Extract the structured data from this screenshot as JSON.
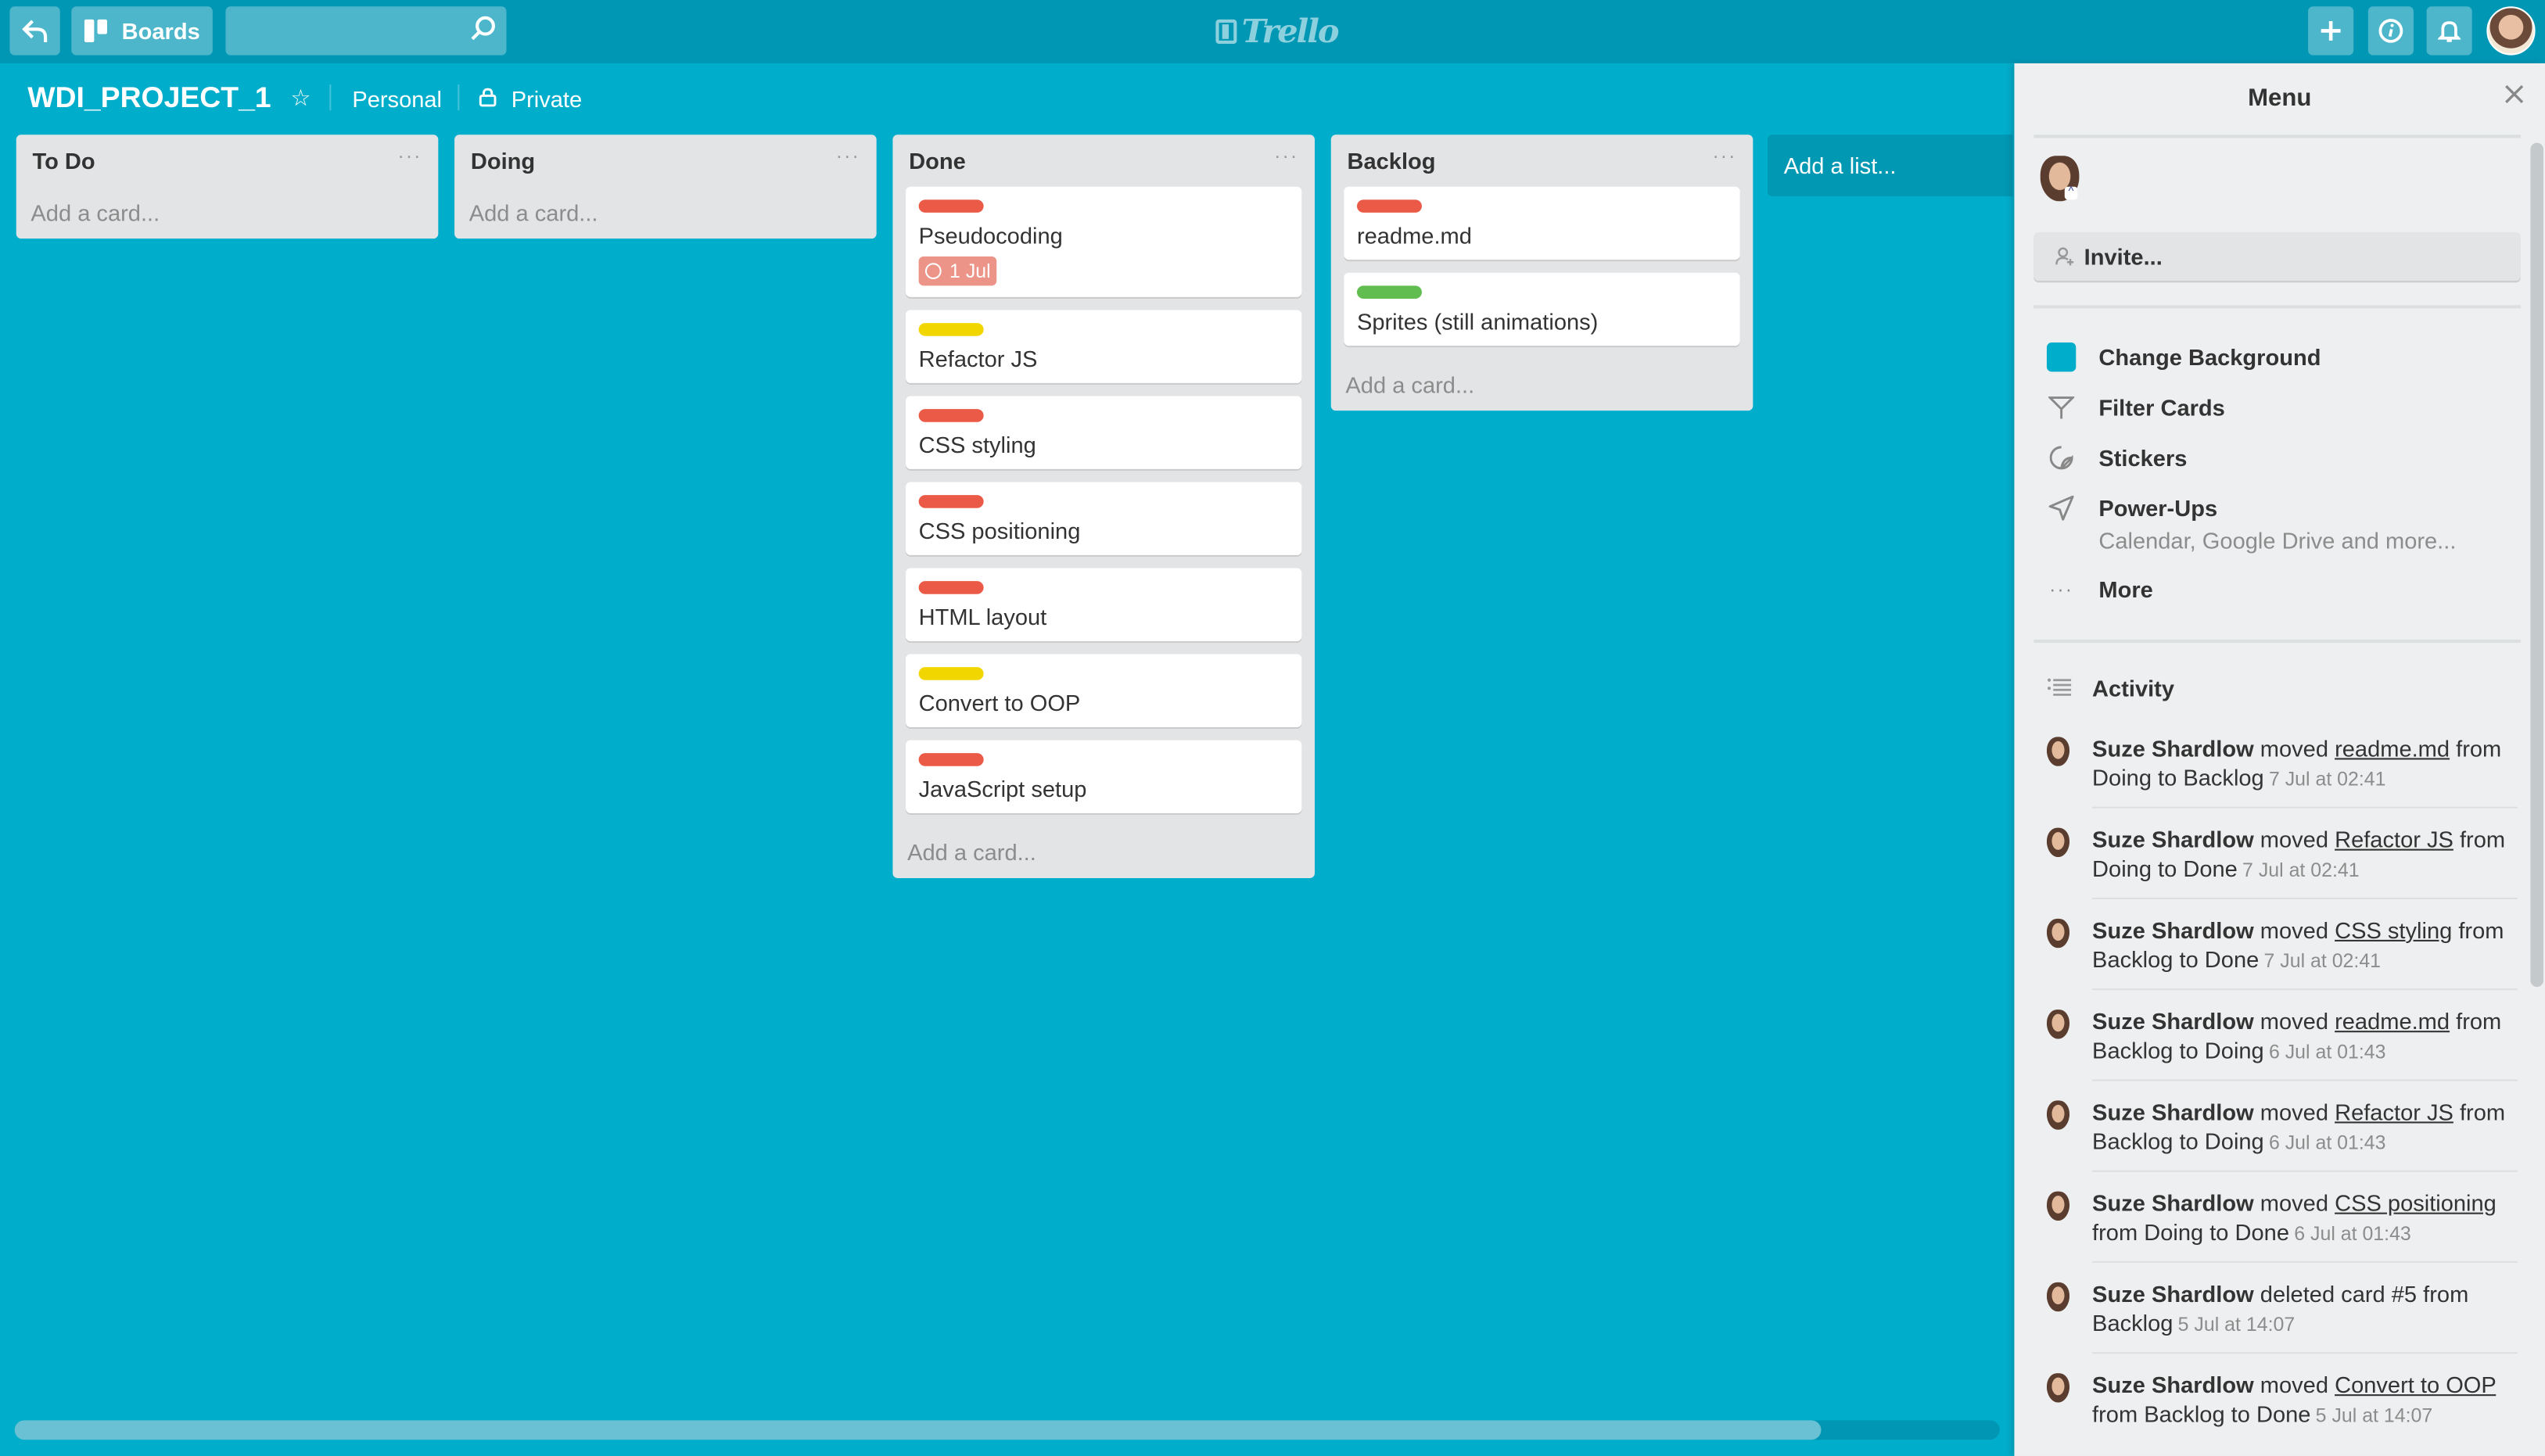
{
  "header": {
    "back_icon": "back-arrow-icon",
    "boards_label": "Boards",
    "search_placeholder": "",
    "logo_text": "Trello",
    "actions": [
      "add-icon",
      "info-icon",
      "bell-icon"
    ]
  },
  "board": {
    "title": "WDI_PROJECT_1",
    "team": "Personal",
    "visibility": "Private"
  },
  "lists": [
    {
      "title": "To Do",
      "menu": "···",
      "cards": [],
      "add_card": "Add a card..."
    },
    {
      "title": "Doing",
      "menu": "···",
      "cards": [],
      "add_card": "Add a card..."
    },
    {
      "title": "Done",
      "menu": "···",
      "add_card": "Add a card...",
      "cards": [
        {
          "title": "Pseudocoding",
          "label": "red",
          "due": "1 Jul"
        },
        {
          "title": "Refactor JS",
          "label": "yellow"
        },
        {
          "title": "CSS styling",
          "label": "red"
        },
        {
          "title": "CSS positioning",
          "label": "red"
        },
        {
          "title": "HTML layout",
          "label": "red"
        },
        {
          "title": "Convert to OOP",
          "label": "yellow"
        },
        {
          "title": "JavaScript setup",
          "label": "red"
        }
      ]
    },
    {
      "title": "Backlog",
      "menu": "···",
      "add_card": "Add a card...",
      "cards": [
        {
          "title": "readme.md",
          "label": "red"
        },
        {
          "title": "Sprites (still animations)",
          "label": "green"
        }
      ]
    }
  ],
  "add_list": "Add a list...",
  "label_colors": {
    "red": "#eb5a46",
    "yellow": "#f2d600",
    "green": "#61bd4f"
  },
  "colors": {
    "board_bg": "#00aecc",
    "header_bg": "#0097b5",
    "due_overdue": "#ec9488"
  },
  "scroll": {
    "horizontal_fraction": 0.91
  },
  "menu": {
    "title": "Menu",
    "invite": "Invite...",
    "items": [
      {
        "label": "Change Background",
        "icon": "color-swatch-icon"
      },
      {
        "label": "Filter Cards",
        "icon": "filter-icon"
      },
      {
        "label": "Stickers",
        "icon": "sticker-icon"
      },
      {
        "label": "Power-Ups",
        "icon": "rocket-icon",
        "sub": "Calendar, Google Drive and more..."
      },
      {
        "label": "More",
        "icon": "more-icon"
      }
    ],
    "activity_title": "Activity",
    "activity": [
      {
        "user": "Suze Shardlow",
        "verb": "moved",
        "link": "readme.md",
        "rest1": "from",
        "rest2": "Doing to Backlog",
        "time": "7 Jul at 02:41"
      },
      {
        "user": "Suze Shardlow",
        "verb": "moved",
        "link": "Refactor JS",
        "rest1": "from",
        "rest2": "Doing to Done",
        "time": "7 Jul at 02:41"
      },
      {
        "user": "Suze Shardlow",
        "verb": "moved",
        "link": "CSS styling",
        "rest1": "from",
        "rest2": "Backlog to Done",
        "time": "7 Jul at 02:41"
      },
      {
        "user": "Suze Shardlow",
        "verb": "moved",
        "link": "readme.md",
        "rest1": "from",
        "rest2": "Backlog to Doing",
        "time": "6 Jul at 01:43"
      },
      {
        "user": "Suze Shardlow",
        "verb": "moved",
        "link": "Refactor JS",
        "rest1": "from",
        "rest2": "Backlog to Doing",
        "time": "6 Jul at 01:43"
      },
      {
        "user": "Suze Shardlow",
        "verb": "moved",
        "link": "CSS positioning",
        "rest1": "",
        "rest2": "from Doing to Done",
        "time": "6 Jul at 01:43"
      },
      {
        "user": "Suze Shardlow",
        "verb": "deleted card #5 from",
        "link": "",
        "rest1": "",
        "rest2": "Backlog",
        "time": "5 Jul at 14:07"
      },
      {
        "user": "Suze Shardlow",
        "verb": "moved",
        "link": "Convert to OOP",
        "rest1": "",
        "rest2": "from Backlog to Done",
        "time": "5 Jul at 14:07"
      }
    ]
  }
}
